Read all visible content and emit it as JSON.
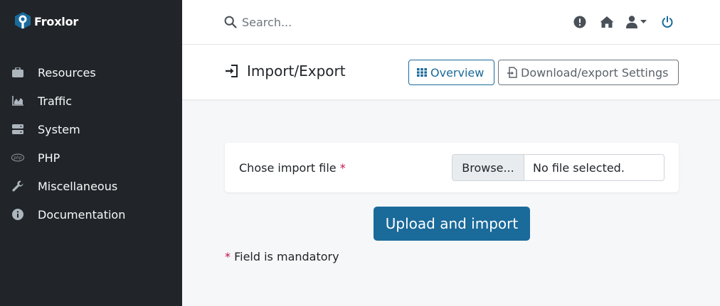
{
  "app": {
    "brand": "Froxlor"
  },
  "sidebar": {
    "items": [
      {
        "label": "Resources",
        "icon": "briefcase-icon"
      },
      {
        "label": "Traffic",
        "icon": "area-chart-icon"
      },
      {
        "label": "System",
        "icon": "server-icon"
      },
      {
        "label": "PHP",
        "icon": "php-icon"
      },
      {
        "label": "Miscellaneous",
        "icon": "wrench-icon"
      },
      {
        "label": "Documentation",
        "icon": "info-circle-icon"
      }
    ]
  },
  "topbar": {
    "search": {
      "placeholder": "Search..."
    },
    "icons": [
      "alert-icon",
      "home-icon",
      "user-icon",
      "power-icon"
    ]
  },
  "page": {
    "title": "Import/Export",
    "overview_label": "Overview",
    "download_label": "Download/export Settings"
  },
  "form": {
    "field_label": "Chose import file",
    "required_mark": "*",
    "browse_label": "Browse...",
    "file_status": "No file selected.",
    "submit_label": "Upload and import",
    "mandatory_note": "Field is mandatory"
  },
  "colors": {
    "sidebar_bg": "#212529",
    "primary": "#1a6a9a",
    "required": "#c0104a",
    "content_bg": "#f6f7f9"
  }
}
